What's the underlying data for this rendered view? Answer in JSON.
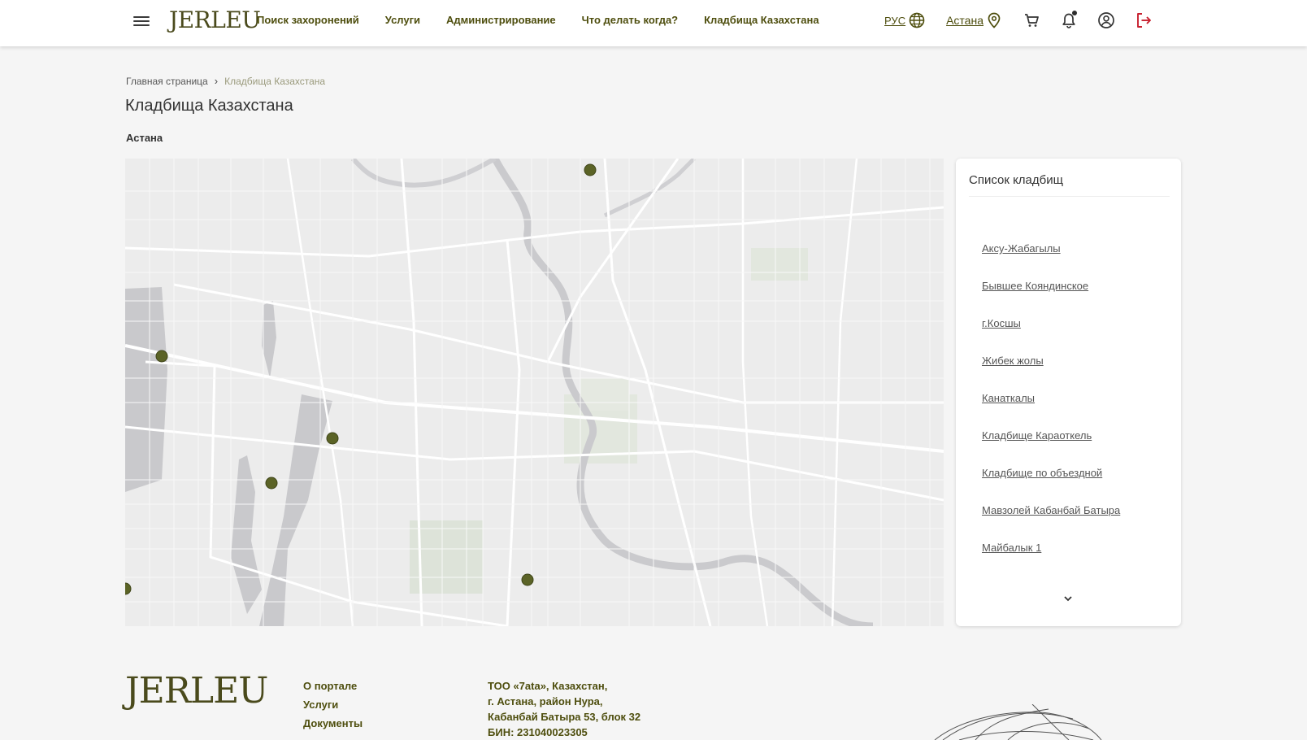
{
  "header": {
    "logo": "JERLEU",
    "nav": [
      "Поиск захоронений",
      "Услуги",
      "Администрирование",
      "Что делать когда?",
      "Кладбища Казахстана"
    ],
    "lang": "РУС",
    "city": "Астана"
  },
  "breadcrumb": {
    "home": "Главная страница",
    "separator": "›",
    "current": "Кладбища Казахстана"
  },
  "page": {
    "title": "Кладбища Казахстана",
    "region": "Астана"
  },
  "panel": {
    "title": "Список кладбищ",
    "items": [
      "Аксу-Жабагылы",
      "Бывшее Кояндинское",
      "г.Косшы",
      "Жибек жолы",
      "Канаткалы",
      "Кладбище Караоткель",
      "Кладбище по объездной",
      "Мавзолей Кабанбай Батыра",
      "Майбалык 1"
    ]
  },
  "footer": {
    "logo": "JERLEU",
    "links": [
      "О портале",
      "Услуги",
      "Документы"
    ],
    "info": [
      "ТОО «7ata», Казахстан,",
      "г. Астана, район Нура,",
      "Кабанбай Батыра 53, блок 32",
      "БИН: 231040023305"
    ]
  },
  "colors": {
    "accent": "#4e4e0e",
    "marker": "#5b6326",
    "logout": "#c8202f"
  },
  "icons": [
    "menu-icon",
    "globe-icon",
    "location-pin-icon",
    "cart-icon",
    "bell-icon",
    "user-icon",
    "logout-icon",
    "chevron-down-icon"
  ]
}
